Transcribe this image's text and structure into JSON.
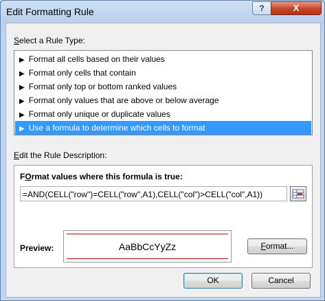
{
  "window": {
    "title": "Edit Formatting Rule",
    "help_label": "?",
    "close_label": "X"
  },
  "rule_type": {
    "label_mnemonic": "S",
    "label_rest": "elect a Rule Type:",
    "items": [
      {
        "label": "Format all cells based on their values",
        "selected": false
      },
      {
        "label": "Format only cells that contain",
        "selected": false
      },
      {
        "label": "Format only top or bottom ranked values",
        "selected": false
      },
      {
        "label": "Format only values that are above or below average",
        "selected": false
      },
      {
        "label": "Format only unique or duplicate values",
        "selected": false
      },
      {
        "label": "Use a formula to determine which cells to format",
        "selected": true
      }
    ]
  },
  "description": {
    "label_mnemonic": "E",
    "label_rest": "dit the Rule Description:",
    "formula_heading_mnemonic": "O",
    "formula_heading_before": "F",
    "formula_heading_after": "rmat values where this formula is true:",
    "formula_value": "=AND(CELL(\"row\")=CELL(\"row\",A1),CELL(\"col\")>CELL(\"col\",A1))",
    "preview_label": "Preview:",
    "preview_sample": "AaBbCcYyZz",
    "format_button_mnemonic": "F",
    "format_button_rest": "ormat..."
  },
  "buttons": {
    "ok": "OK",
    "cancel": "Cancel"
  },
  "icons": {
    "arrow": "▶",
    "ref": "range-selector-icon"
  },
  "colors": {
    "selection": "#3399ff",
    "preview_border": "#c00000",
    "close": "#c5452b"
  }
}
